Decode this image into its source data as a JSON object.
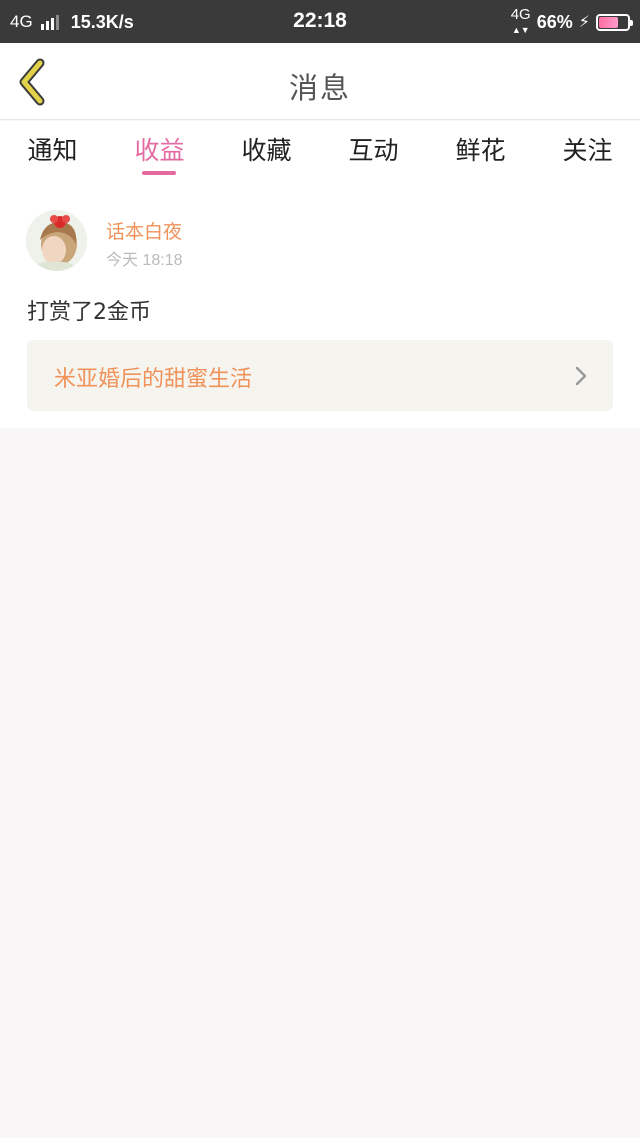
{
  "status_bar": {
    "network_left": "4G",
    "speed": "15.3K/s",
    "time": "22:18",
    "network_right": "4G",
    "battery": "66%",
    "battery_level": 0.66,
    "icons": [
      "signal-icon",
      "battery-icon",
      "charging-icon"
    ]
  },
  "header": {
    "title": "消息",
    "back_icon": "chevron-left-icon",
    "accent_color": "#e2d24a"
  },
  "tabs": [
    {
      "label": "通知",
      "active": false
    },
    {
      "label": "收益",
      "active": true
    },
    {
      "label": "收藏",
      "active": false
    },
    {
      "label": "互动",
      "active": false
    },
    {
      "label": "鲜花",
      "active": false
    },
    {
      "label": "关注",
      "active": false
    }
  ],
  "colors": {
    "active_tab": "#e36aa1",
    "name": "#f0935a",
    "card_background": "#f5f4ef"
  },
  "message": {
    "user_name": "话本白夜",
    "time": "今天 18:18",
    "text": "打赏了2金币",
    "story_title": "米亚婚后的甜蜜生活",
    "card_icon": "chevron-right-icon"
  }
}
